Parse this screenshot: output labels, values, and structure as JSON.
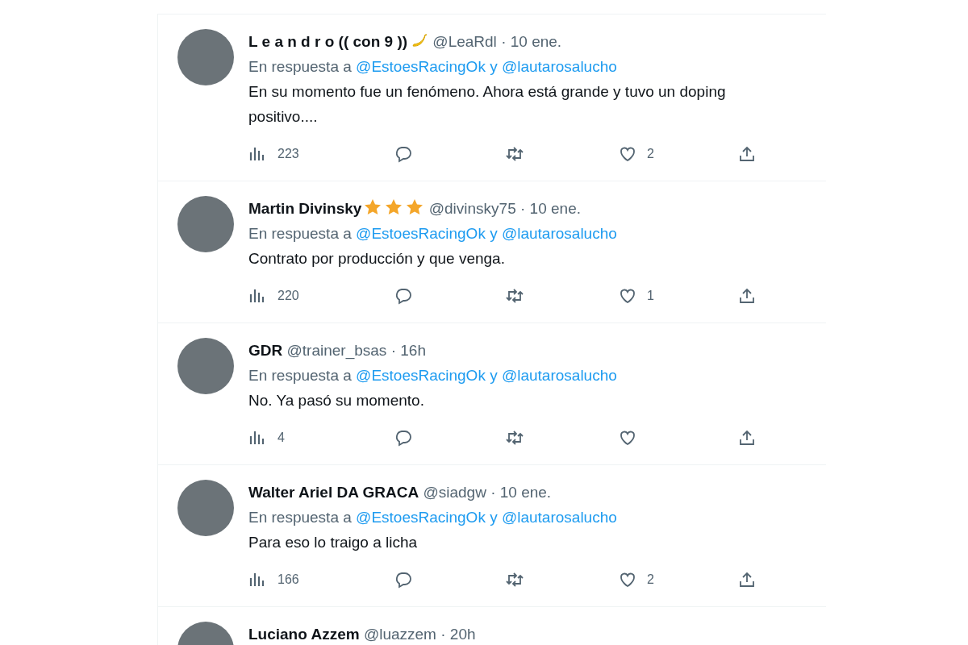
{
  "replies": [
    {
      "name": "L e a n d r o (( con 9 ))",
      "name_emojis": [
        {
          "kind": "banana"
        }
      ],
      "handle": "@LeaRdl",
      "separator": "·",
      "time": "10 ene.",
      "reply_prefix": "En respuesta a",
      "mentions": [
        "@EstoesRacingOk",
        "@lautarosalucho"
      ],
      "joiner": "y",
      "text": "En su momento fue un fenómeno. Ahora está grande y tuvo un doping positivo....",
      "views": "223",
      "likes": "2"
    },
    {
      "name": "Martin Divinsky",
      "name_emojis": [
        {
          "kind": "star"
        },
        {
          "kind": "star"
        },
        {
          "kind": "star"
        }
      ],
      "handle": "@divinsky75",
      "separator": "·",
      "time": "10 ene.",
      "reply_prefix": "En respuesta a",
      "mentions": [
        "@EstoesRacingOk",
        "@lautarosalucho"
      ],
      "joiner": "y",
      "text": "Contrato por producción y que venga.",
      "views": "220",
      "likes": "1"
    },
    {
      "name": "GDR",
      "handle": "@trainer_bsas",
      "separator": "·",
      "time": "16h",
      "reply_prefix": "En respuesta a",
      "mentions": [
        "@EstoesRacingOk",
        "@lautarosalucho"
      ],
      "joiner": "y",
      "text": "No. Ya pasó su momento.",
      "views": "4"
    },
    {
      "name": "Walter Ariel DA GRACA",
      "handle": "@siadgw",
      "separator": "·",
      "time": "10 ene.",
      "reply_prefix": "En respuesta a",
      "mentions": [
        "@EstoesRacingOk",
        "@lautarosalucho"
      ],
      "joiner": "y",
      "text": "Para eso lo traigo a licha",
      "views": "166",
      "likes": "2"
    },
    {
      "name": "Luciano Azzem",
      "handle": "@luazzem",
      "separator": "·",
      "time": "20h"
    }
  ]
}
